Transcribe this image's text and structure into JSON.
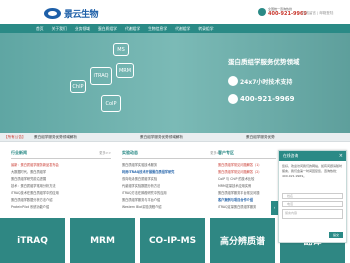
{
  "header": {
    "logo_text": "景云生物",
    "phone_label": "全国统一咨询热线",
    "phone": "400-921-9969",
    "top_links": "在线留言 | 邮箱登陆"
  },
  "nav": [
    "首页",
    "关于我们",
    "业务领域",
    "蛋白质组学",
    "代谢组学",
    "生物信息学",
    "代谢组学",
    "转录组学"
  ],
  "banner": {
    "hexes": [
      "MS",
      "iTRAQ",
      "MRM",
      "ChIP",
      "CoIP"
    ],
    "title": "蛋白质组学服务优势领域",
    "support": "24x7小时技术支持",
    "phone": "400-921-9969"
  },
  "news_bar": {
    "label": "【所有公告】",
    "items": [
      "蛋白组学服务优势领域解析",
      "蛋白组学服务优势领域解析",
      "蛋白组学服务优势"
    ]
  },
  "columns": [
    {
      "title": "行业新闻",
      "more": "更多>>",
      "items": [
        "最新：蛋白质组学服务新品发布会",
        "大数据时代，蛋白质组学",
        "蛋白质组学研究前沿进展",
        "技术：蛋白质组学常用分析方法",
        "iTRAQ技术在蛋白质组学中的应用",
        "蛋白质组学数据分析方法介绍",
        "ProteinPilot 系统功能介绍"
      ]
    },
    {
      "title": "实验动态",
      "more": "更多>>",
      "items": [
        "蛋白质组学实验技术服务",
        "利用iTRAQ技术开展蛋白质组学研究",
        "双向电泳蛋白质组学实验",
        "代谢组学实验数据分析方法",
        "iTRAQ方法在肿瘤研究中的应用",
        "蛋白质组学服务与平台介绍",
        "Western Blot实验流程介绍"
      ]
    },
    {
      "title": "客户专区",
      "more": "更多>>",
      "items": [
        "蛋白质组学常见问题解答（1）",
        "蛋白质组学常见问题解答（2）",
        "CoIP 与 ChIP 的技术比较",
        "MRM定量技术应用实例",
        "蛋白质组学服务平台常见问题",
        "客户案例与项目合作介绍",
        "iTRAQ定量蛋白质组学服务"
      ]
    }
  ],
  "tiles": [
    "iTRAQ",
    "MRM",
    "CO-IP-MS",
    "高分辨质谱",
    "翻译"
  ],
  "chat": {
    "title": "在线咨询",
    "body": "您好，欢迎访问我们的网站，如有问题请随时留言，我们会第一时间回复您，咨询热线：400-921-9969。",
    "name_ph": "姓名",
    "phone_ph": "电话",
    "msg_ph": "留言内容",
    "submit": "提交"
  }
}
